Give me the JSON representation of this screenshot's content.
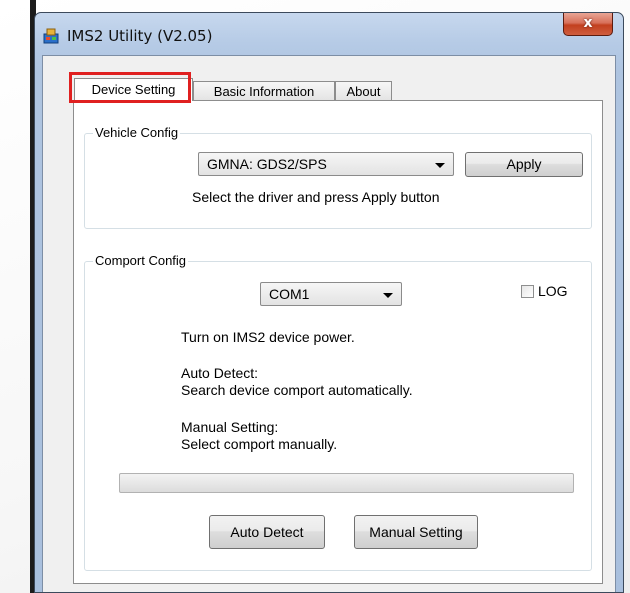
{
  "window": {
    "title": "IMS2 Utility (V2.05)",
    "close_glyph": "x"
  },
  "tabs": [
    {
      "label": "Device Setting",
      "active": true
    },
    {
      "label": "Basic Information",
      "active": false
    },
    {
      "label": "About",
      "active": false
    }
  ],
  "highlight_color": "#e02020",
  "vehicle_config": {
    "legend": "Vehicle Config",
    "driver_select": {
      "value": "GMNA: GDS2/SPS"
    },
    "apply_label": "Apply",
    "hint": "Select the driver and press Apply button"
  },
  "comport_config": {
    "legend": "Comport Config",
    "port_select": {
      "value": "COM1"
    },
    "log_label": "LOG",
    "log_checked": false,
    "line1": "Turn on IMS2 device power.",
    "auto_title": "Auto Detect:",
    "auto_desc": "Search device comport automatically.",
    "manual_title": "Manual Setting:",
    "manual_desc": "Select comport manually.",
    "progress": 0,
    "auto_detect_label": "Auto Detect",
    "manual_setting_label": "Manual Setting"
  }
}
